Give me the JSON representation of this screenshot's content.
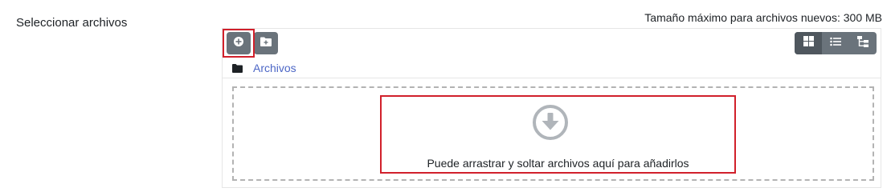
{
  "form": {
    "field_label": "Seleccionar archivos",
    "max_size_text": "Tamaño máximo para archivos nuevos: 300 MB"
  },
  "filepicker": {
    "path": {
      "folder_icon": "folder-icon",
      "link": "Archivos"
    },
    "toolbar": {
      "add_icon": "plus-circle-icon",
      "new_folder_icon": "folder-plus-icon",
      "views": [
        {
          "icon": "grid-icon",
          "active": true
        },
        {
          "icon": "list-icon",
          "active": false
        },
        {
          "icon": "tree-icon",
          "active": false
        }
      ]
    },
    "dropzone": {
      "icon": "arrow-down-circle-icon",
      "text": "Puede arrastrar y soltar archivos aquí para añadirlos"
    }
  },
  "colors": {
    "highlight": "#d1202b",
    "button": "#6a737b",
    "link": "#4d67c6"
  }
}
